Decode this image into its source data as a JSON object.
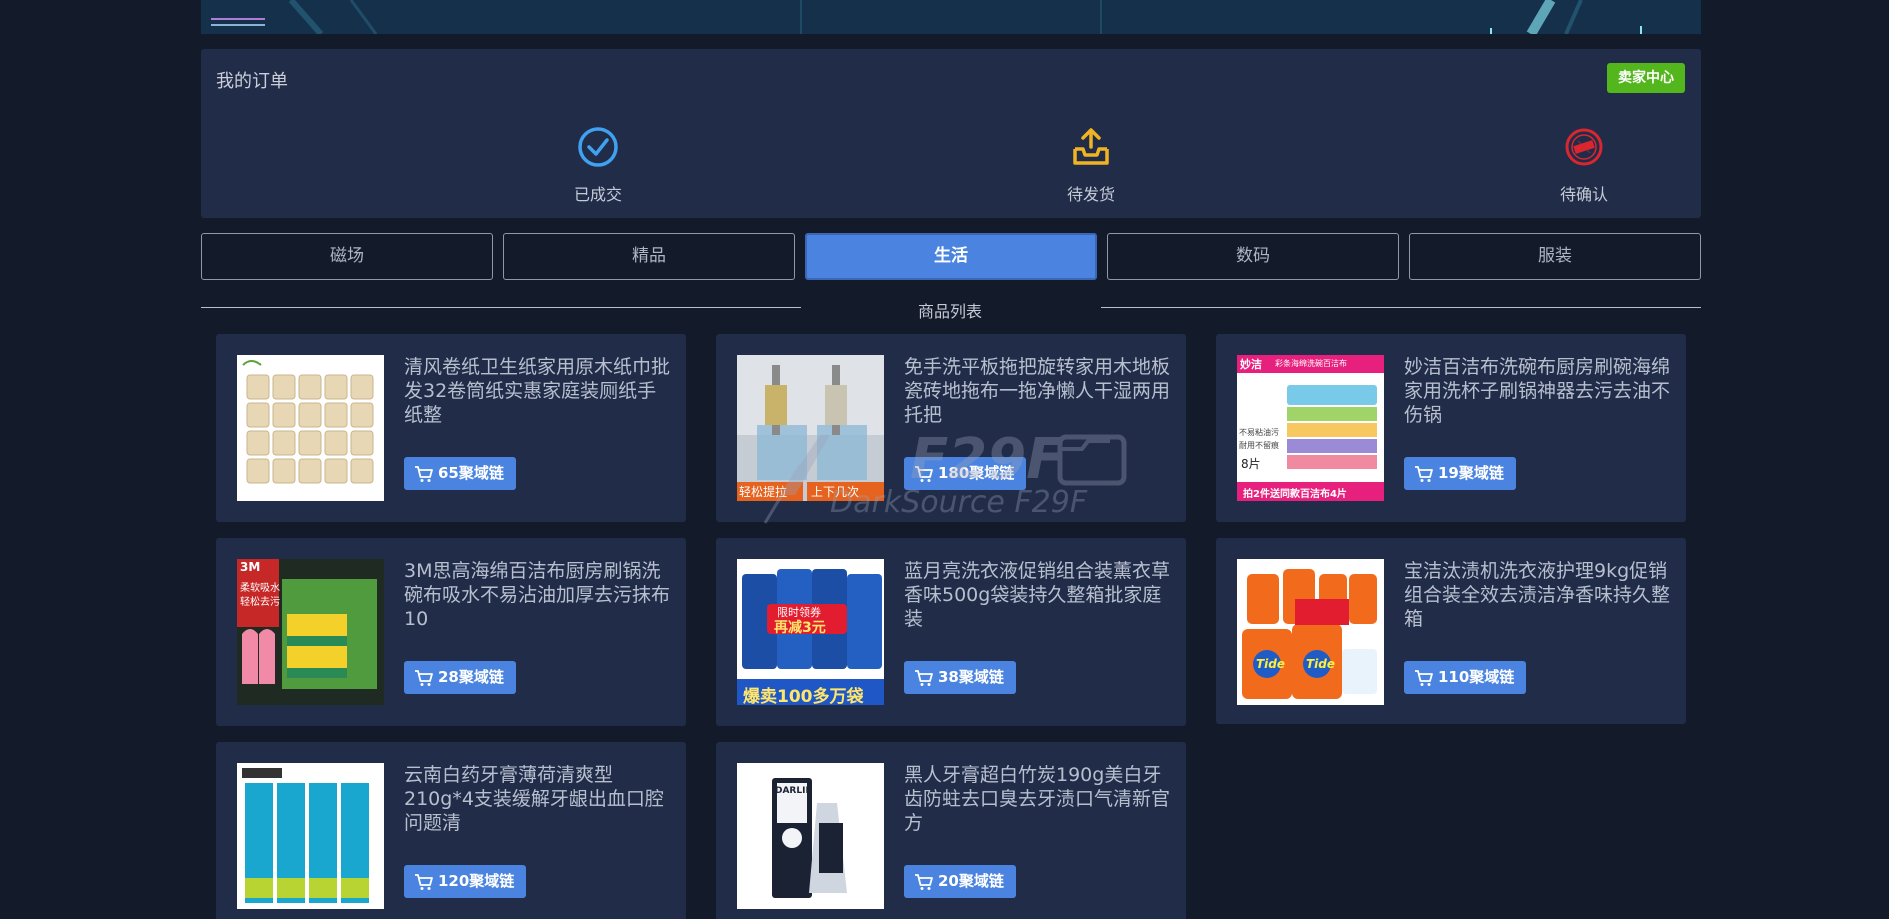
{
  "orders": {
    "title": "我的订单",
    "seller_center": "卖家中心",
    "statuses": [
      {
        "label": "已成交",
        "icon": "check-circle-icon"
      },
      {
        "label": "待发货",
        "icon": "inbox-upload-icon"
      },
      {
        "label": "待确认",
        "icon": "seal-stamp-icon"
      }
    ]
  },
  "tabs": [
    {
      "label": "磁场"
    },
    {
      "label": "精品"
    },
    {
      "label": "生活",
      "active": true
    },
    {
      "label": "数码"
    },
    {
      "label": "服装"
    }
  ],
  "section_title": "商品列表",
  "products": [
    {
      "name": "清风卷纸卫生纸家用原木纸巾批发32卷筒纸实惠家庭装厕纸手纸整",
      "price": "65聚域链"
    },
    {
      "name": "免手洗平板拖把旋转家用木地板瓷砖地拖布一拖净懒人干湿两用托把",
      "price": "180聚域链",
      "img_text": [
        "轻松提拉",
        "上下几次"
      ]
    },
    {
      "name": "妙洁百洁布洗碗布厨房刷碗海绵家用洗杯子刷锅神器去污去油不伤锅",
      "price": "19聚域链",
      "img_text": [
        "妙洁",
        "彩条海绵洗碗百洁布",
        "不易粘油污",
        "耐用不留痕",
        "8片",
        "拍2件送同款百洁布4片"
      ]
    },
    {
      "name": "3M思高海绵百洁布厨房刷锅洗碗布吸水不易沾油加厚去污抹布10",
      "price": "28聚域链",
      "img_text": [
        "3M",
        "柔软吸水",
        "轻松去污"
      ]
    },
    {
      "name": "蓝月亮洗衣液促销组合装薰衣草香味500g袋装持久整箱批家庭装",
      "price": "38聚域链",
      "img_text": [
        "限时领券",
        "再减3元",
        "爆卖100多万袋"
      ]
    },
    {
      "name": "宝洁汰渍机洗衣液护理9kg促销组合装全效去渍洁净香味持久整箱",
      "price": "110聚域链",
      "img_text": [
        "Tide",
        "Tide"
      ]
    },
    {
      "name": "云南白药牙膏薄荷清爽型210g*4支装缓解牙龈出血口腔问题清",
      "price": "120聚域链"
    },
    {
      "name": "黑人牙膏超白竹炭190g美白牙齿防蛀去口臭去牙渍口气清新官方",
      "price": "20聚域链",
      "img_text": [
        "DARLIE"
      ]
    }
  ],
  "watermark": {
    "brand": "F29F",
    "text": "DarkSource F29F"
  },
  "colors": {
    "background": "#131a29",
    "panel": "#212c48",
    "accent_blue": "#4a84e0",
    "seller_green": "#52b61c",
    "check_icon": "#3fa1f0",
    "upload_icon": "#f0b323",
    "seal_icon": "#d9262f"
  }
}
